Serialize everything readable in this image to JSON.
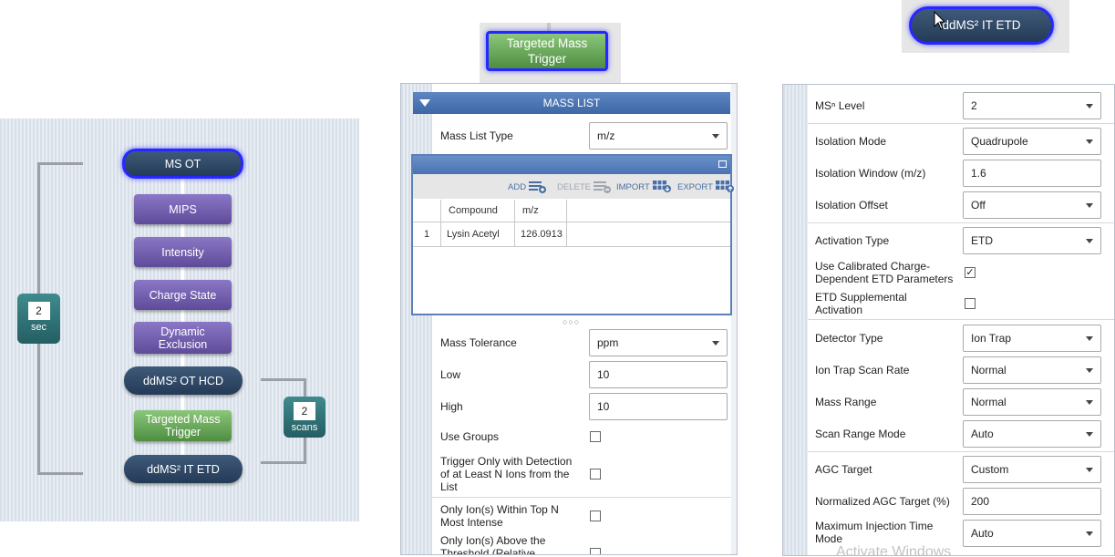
{
  "tree": {
    "ms_ot": "MS OT",
    "mips": "MIPS",
    "intensity": "Intensity",
    "charge_state": "Charge State",
    "dynamic_exclusion": "Dynamic Exclusion",
    "ddms2_ot_hcd": "ddMS² OT HCD",
    "targeted_mass_trigger": "Targeted Mass Trigger",
    "ddms2_it_etd": "ddMS² IT ETD",
    "loop_time": {
      "value": "2",
      "unit": "sec"
    },
    "loop_scans": {
      "value": "2",
      "unit": "scans"
    }
  },
  "trigger_panel": {
    "node_label": "Targeted Mass Trigger",
    "section_title": "MASS LIST",
    "mass_list_type": {
      "label": "Mass List Type",
      "value": "m/z"
    },
    "toolbar": {
      "add": "ADD",
      "delete": "DELETE",
      "import": "IMPORT",
      "export": "EXPORT"
    },
    "table": {
      "columns": [
        "Compound",
        "m/z"
      ],
      "rows": [
        {
          "index": "1",
          "compound": "Lysin Acetyl",
          "mz": "126.0913"
        }
      ]
    },
    "mass_tolerance": {
      "label": "Mass Tolerance",
      "value": "ppm"
    },
    "low": {
      "label": "Low",
      "value": "10"
    },
    "high": {
      "label": "High",
      "value": "10"
    },
    "use_groups": {
      "label": "Use Groups",
      "checked": false
    },
    "trigger_n_ions": {
      "label": "Trigger Only with Detection of at Least N Ions from the List",
      "checked": false
    },
    "top_n": {
      "label": "Only Ion(s) Within Top N Most Intense",
      "checked": false
    },
    "above_threshold": {
      "label": "Only Ion(s) Above the Threshold (Relative Intensity)"
    }
  },
  "etd_panel": {
    "node_label": "ddMS² IT ETD",
    "rows": {
      "msn_level": {
        "label": "MSⁿ Level",
        "value": "2"
      },
      "isolation_mode": {
        "label": "Isolation Mode",
        "value": "Quadrupole"
      },
      "isolation_window": {
        "label": "Isolation Window (m/z)",
        "value": "1.6"
      },
      "isolation_offset": {
        "label": "Isolation Offset",
        "value": "Off"
      },
      "activation_type": {
        "label": "Activation Type",
        "value": "ETD"
      },
      "use_calibrated": {
        "label": "Use Calibrated Charge-Dependent ETD Parameters",
        "checked": true
      },
      "etd_supplemental": {
        "label": "ETD Supplemental Activation",
        "checked": false
      },
      "detector_type": {
        "label": "Detector Type",
        "value": "Ion Trap"
      },
      "scan_rate": {
        "label": "Ion Trap Scan Rate",
        "value": "Normal"
      },
      "mass_range": {
        "label": "Mass Range",
        "value": "Normal"
      },
      "scan_range_mode": {
        "label": "Scan Range Mode",
        "value": "Auto"
      },
      "agc_target": {
        "label": "AGC Target",
        "value": "Custom"
      },
      "normalized_agc": {
        "label": "Normalized AGC Target (%)",
        "value": "200"
      },
      "max_injection": {
        "label": "Maximum Injection Time Mode",
        "value": "Auto"
      }
    },
    "watermark": "Activate Windows"
  },
  "colors": {
    "navy_node": "#2f4a6a",
    "purple_node": "#6e5bab",
    "green_node": "#5f9f50",
    "loop_box": "#2f7478",
    "selection": "#2727ff",
    "section_header": "#4a74b4"
  }
}
